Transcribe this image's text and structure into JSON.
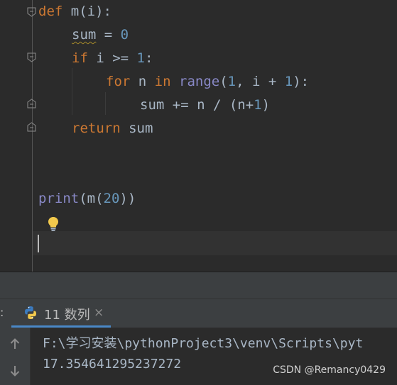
{
  "code": {
    "line1": {
      "kw_def": "def",
      "name": " m(i):"
    },
    "line2": {
      "var": "sum",
      "op": " = ",
      "num": "0"
    },
    "line3": {
      "kw_if": "if",
      "cond": " i >= ",
      "num": "1",
      "colon": ":"
    },
    "line4": {
      "kw_for": "for",
      "n": " n ",
      "kw_in": "in",
      "sp": " ",
      "range": "range",
      "open": "(",
      "num1": "1",
      "mid": ", i + ",
      "num2": "1",
      "close": "):"
    },
    "line5": {
      "body": "sum += n / (n+",
      "num": "1",
      "close": ")"
    },
    "line6": {
      "kw_return": "return",
      "rest": " sum"
    },
    "line8": {
      "print": "print",
      "open": "(m(",
      "num": "20",
      "close": "))"
    }
  },
  "run_panel": {
    "colon": ":",
    "tab_label": "11 数列",
    "close_glyph": "×",
    "console_path": "F:\\学习安装\\pythonProject3\\venv\\Scripts\\pyt",
    "console_output": "17.354641295237272"
  },
  "watermark": "CSDN @Remancy0429",
  "colors": {
    "keyword": "#cc7832",
    "number": "#6897bb",
    "builtin": "#8888c6",
    "text": "#a9b7c6",
    "background": "#2b2b2b",
    "tab_underline": "#4a88c7"
  },
  "icons": {
    "bulb": "lightbulb-icon",
    "python": "python-icon",
    "up": "arrow-up-icon",
    "down": "arrow-down-icon"
  }
}
